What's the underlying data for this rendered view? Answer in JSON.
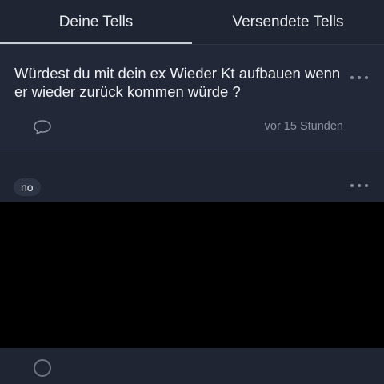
{
  "tabs": [
    {
      "label": "Deine Tells",
      "active": true
    },
    {
      "label": "Versendete Tells",
      "active": false
    }
  ],
  "post": {
    "question": "Würdest du mit dein ex Wieder Kt aufbauen wenn er wieder zurück kommen würde ?",
    "timestamp": "vor 15 Stunden",
    "comment_icon": "speech-bubble-icon",
    "more_icon": "more-options-icon"
  },
  "reply": {
    "tag": "no",
    "more_icon": "more-options-icon",
    "media": "black-image"
  },
  "colors": {
    "background": "#1f2533",
    "card": "#222837",
    "text": "#eef0f3",
    "muted": "#8b92a0",
    "tag_bg": "#2d3444"
  }
}
